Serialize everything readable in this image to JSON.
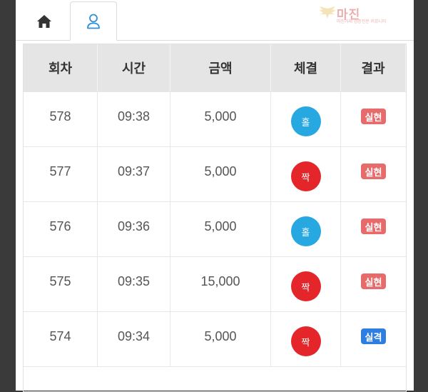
{
  "watermark": {
    "text": "마진",
    "subtext": "마진거래 검증전문 커뮤니티",
    "color": "#e06b6b"
  },
  "tabs": [
    {
      "icon": "home-icon"
    },
    {
      "icon": "user-icon",
      "active": true
    }
  ],
  "table": {
    "headers": [
      "회차",
      "시간",
      "금액",
      "체결",
      "결과"
    ],
    "rows": [
      {
        "round": "578",
        "time": "09:38",
        "amount": "5,000",
        "pick": "홀",
        "pick_color": "#27a8e0",
        "result": "실현",
        "result_color": "#e86b6b"
      },
      {
        "round": "577",
        "time": "09:37",
        "amount": "5,000",
        "pick": "짝",
        "pick_color": "#e4262b",
        "result": "실현",
        "result_color": "#e86b6b"
      },
      {
        "round": "576",
        "time": "09:36",
        "amount": "5,000",
        "pick": "홀",
        "pick_color": "#27a8e0",
        "result": "실현",
        "result_color": "#e86b6b"
      },
      {
        "round": "575",
        "time": "09:35",
        "amount": "15,000",
        "pick": "짝",
        "pick_color": "#e4262b",
        "result": "실현",
        "result_color": "#e86b6b"
      },
      {
        "round": "574",
        "time": "09:34",
        "amount": "5,000",
        "pick": "짝",
        "pick_color": "#e4262b",
        "result": "실격",
        "result_color": "#2d7ee0"
      }
    ]
  }
}
